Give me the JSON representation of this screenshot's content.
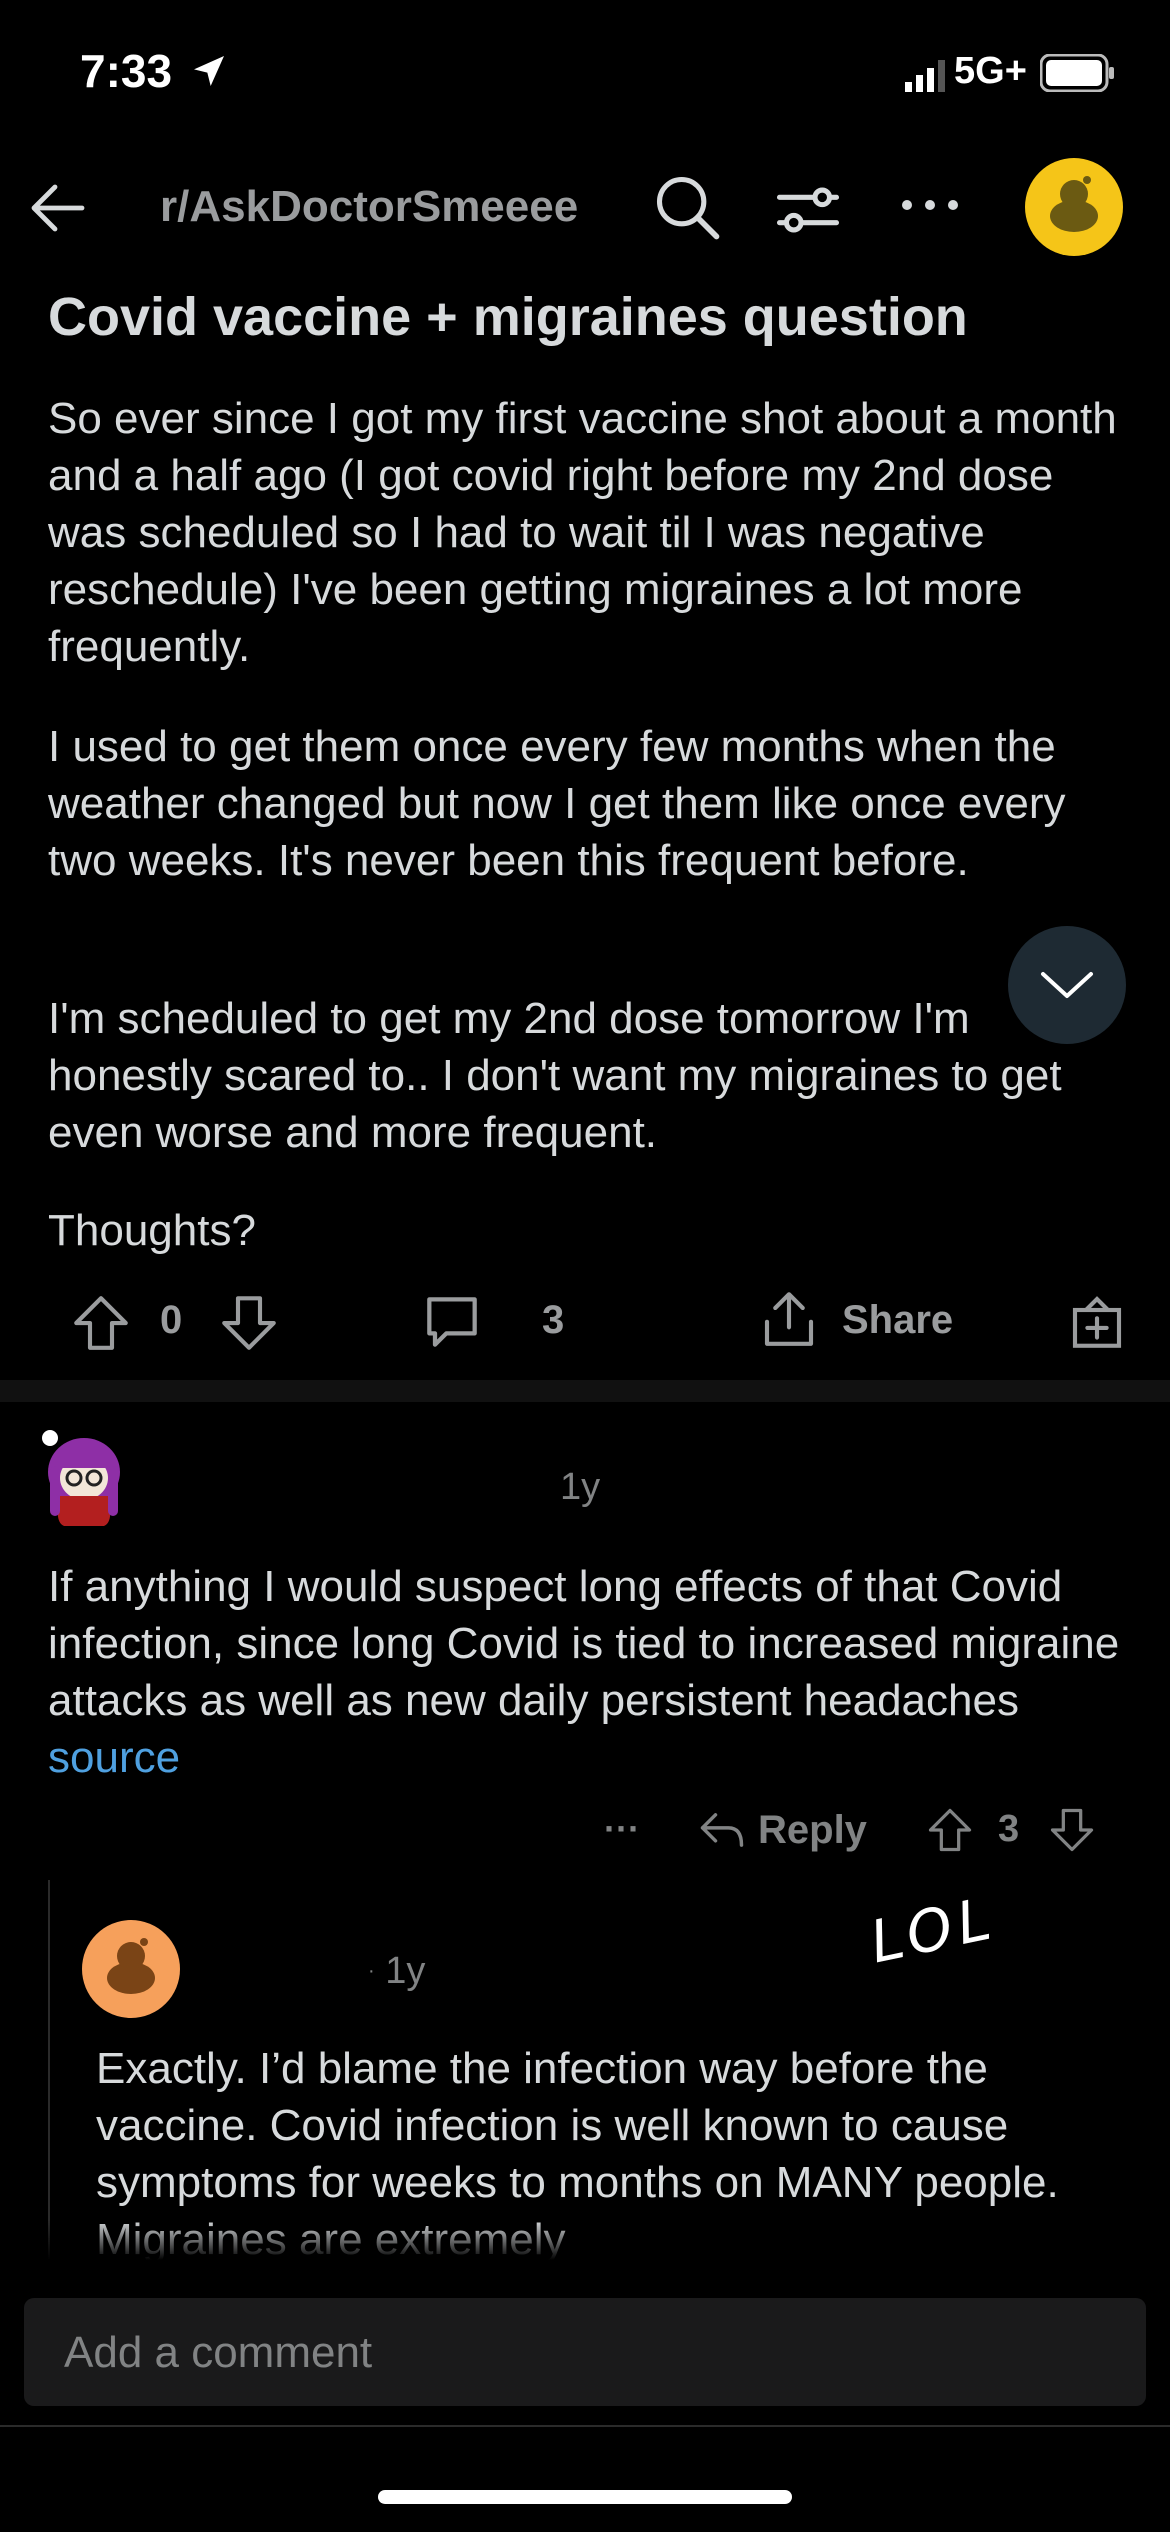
{
  "status": {
    "time": "7:33",
    "network": "5G+"
  },
  "nav": {
    "subreddit": "r/AskDoctorSmeeee"
  },
  "post": {
    "title": "Covid vaccine + migraines question",
    "paragraphs": [
      "So ever since I got my first vaccine shot about a month and a half ago (I got covid right before my 2nd dose was scheduled so I had to wait til I was negative reschedule) I've been getting migraines a lot more frequently.",
      "I used to get them once every few months when the weather changed but now I get them like once every two weeks. It's never been this frequent before.",
      "I'm scheduled to get my 2nd dose tomorrow I'm honestly scared to.. I don't want my migraines to get even worse and more frequent.",
      "Thoughts?"
    ],
    "votes": "0",
    "comments": "3",
    "share_label": "Share"
  },
  "comment1": {
    "age": "1y",
    "text": "If anything I would suspect long effects of that Covid infection, since long Covid is tied to increased migraine attacks as well as new daily persistent headaches",
    "link_text": "source",
    "more": "···",
    "reply_label": "Reply",
    "votes": "3"
  },
  "comment2": {
    "age": "1y",
    "annotation": "LOL",
    "text": "Exactly.  I’d blame the infection way before the vaccine.   Covid infection is well known to cause symptoms for weeks to months on MANY people.  Migraines are extremely"
  },
  "composer": {
    "placeholder": "Add a comment"
  },
  "colors": {
    "accent_link": "#4fa0e0",
    "avatar_yellow": "#f5c518",
    "avatar_orange": "#f6a05b"
  }
}
